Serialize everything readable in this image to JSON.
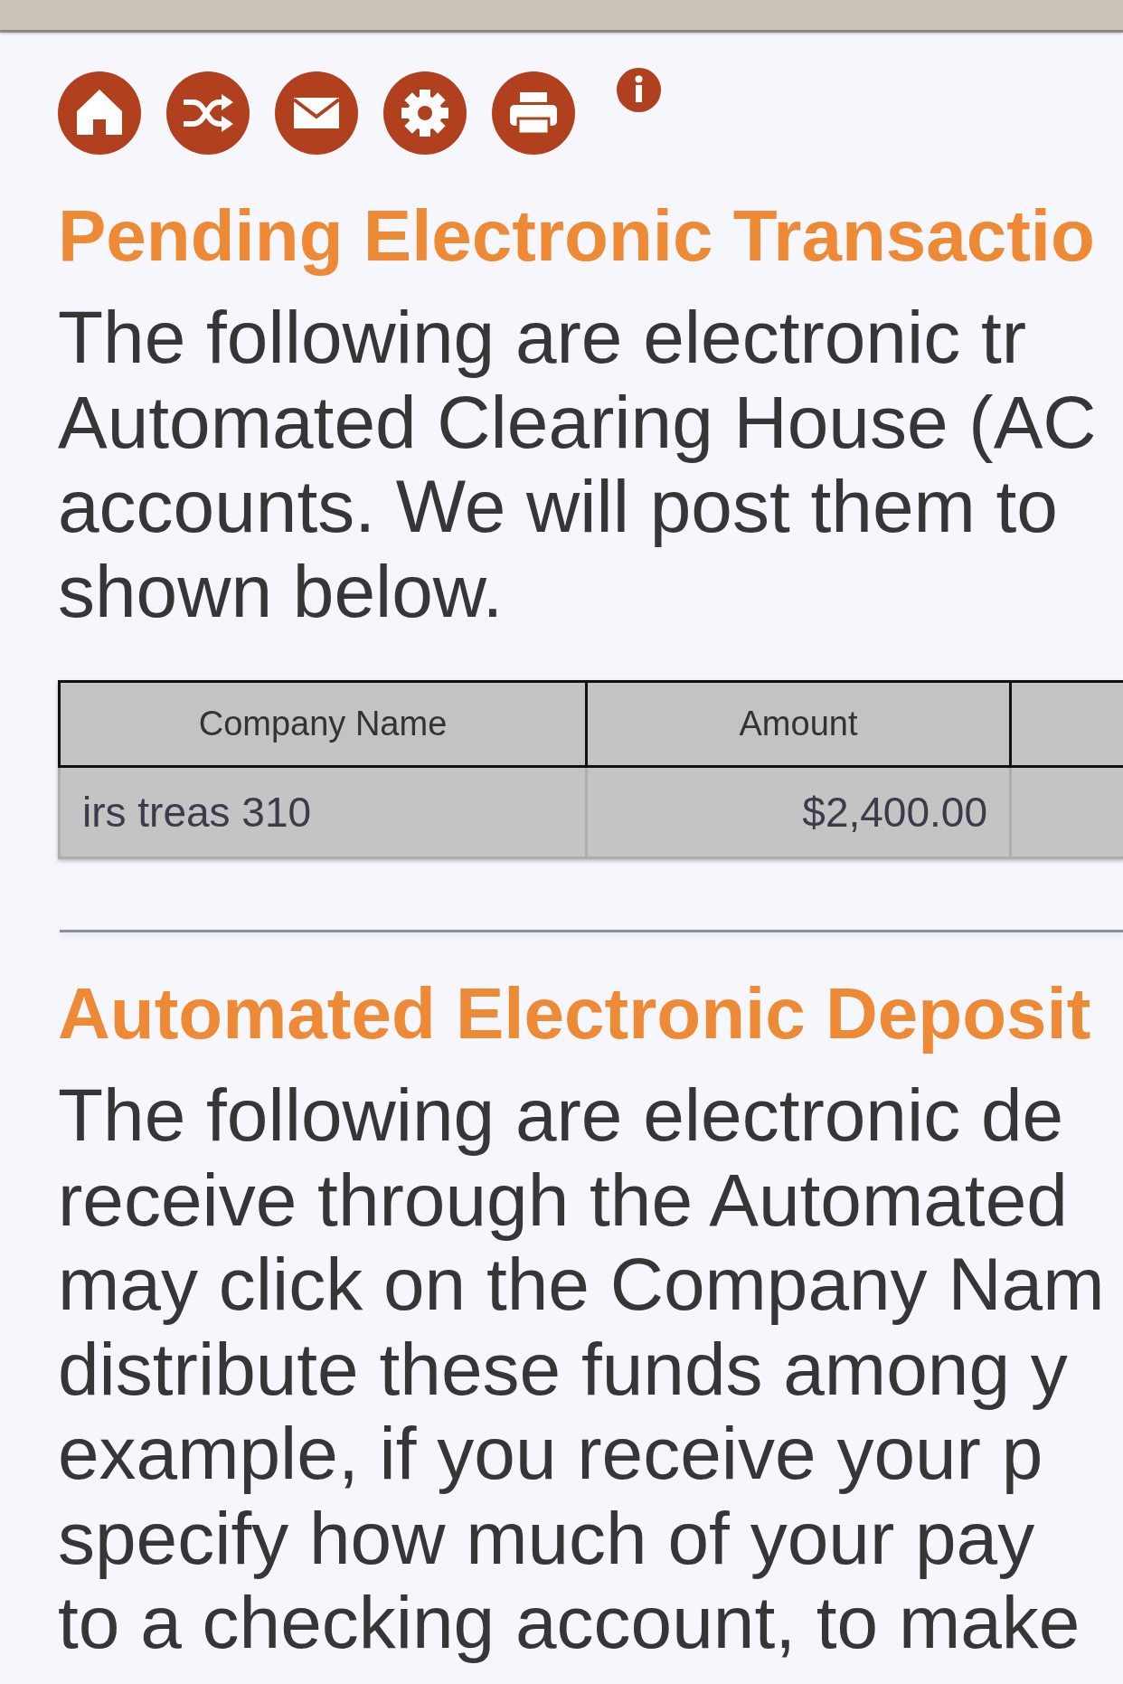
{
  "pending_transactions": {
    "heading": "Pending Electronic Transactio",
    "paragraph_lines": [
      "The following are electronic tr",
      "Automated Clearing House (AC",
      "accounts. We will post them to",
      "shown below."
    ],
    "table": {
      "columns": [
        {
          "kind": "text",
          "label": "Company Name"
        },
        {
          "kind": "money",
          "label": "Amount"
        },
        {
          "kind": "cut_off"
        }
      ],
      "rows": [
        {
          "cells": [
            "irs treas 310",
            "$2,400.00"
          ]
        }
      ]
    }
  },
  "automated_deposits": {
    "heading": "Automated Electronic Deposit",
    "paragraph_lines": [
      "The following are electronic de",
      "receive through the Automated",
      "may click on the Company Nam",
      "distribute these funds among y",
      "example, if you receive your p",
      "specify how much of your pay",
      "to a checking account, to make"
    ]
  }
}
